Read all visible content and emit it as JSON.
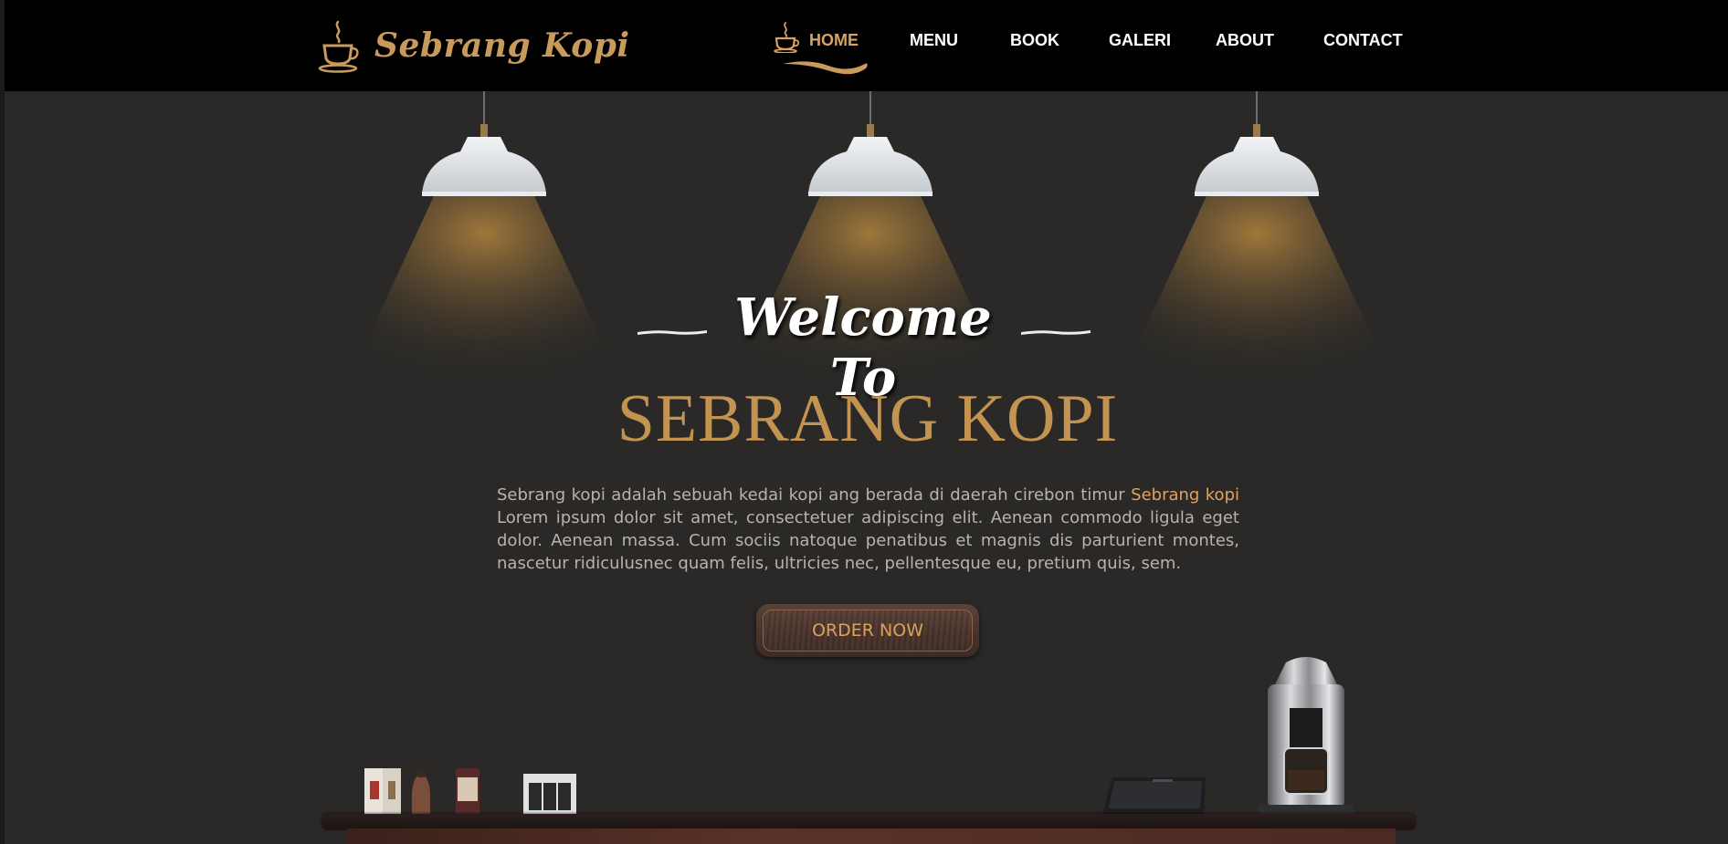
{
  "brand": {
    "name": "Sebrang Kopi",
    "logo_icon": "coffee-cup-icon",
    "accent_color": "#c89a5b"
  },
  "nav": {
    "items": [
      {
        "label": "HOME",
        "active": true
      },
      {
        "label": "MENU",
        "active": false
      },
      {
        "label": "BOOK",
        "active": false
      },
      {
        "label": "GALERI",
        "active": false
      },
      {
        "label": "ABOUT",
        "active": false
      },
      {
        "label": "CONTACT",
        "active": false
      }
    ],
    "active_icon": "coffee-cup-icon",
    "active_color": "#d9a35f"
  },
  "hero": {
    "welcome": "Welcome To",
    "title": "SEBRANG KOPI",
    "desc_before": "Sebrang kopi adalah sebuah kedai kopi ang berada di daerah cirebon timur ",
    "desc_highlight": "Sebrang kopi",
    "desc_after": " Lorem ipsum dolor sit amet, consectetuer adipiscing elit. Aenean commodo ligula eget dolor. Aenean massa. Cum sociis natoque penatibus et magnis dis parturient montes, nascetur ridiculusnec quam felis, ultricies nec, pellentesque eu, pretium quis, sem.",
    "order_button": "ORDER NOW"
  },
  "decor": {
    "lamps": [
      "pendant-lamp-icon",
      "pendant-lamp-icon",
      "pendant-lamp-icon"
    ],
    "counter_items": [
      "coffee-products-icon",
      "cash-register-icon",
      "espresso-machine-icon"
    ]
  }
}
